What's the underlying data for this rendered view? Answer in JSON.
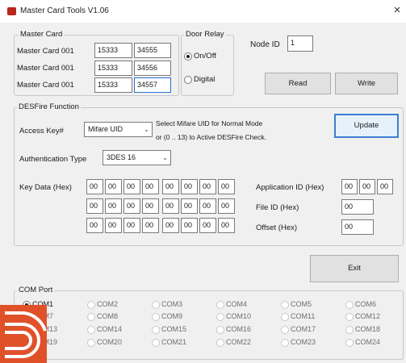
{
  "window": {
    "title": "Master Card Tools V1.06",
    "close_glyph": "×"
  },
  "master_card": {
    "legend": "Master Card",
    "rows": [
      {
        "label": "Master Card 001",
        "value1": "15333",
        "value2": "34555"
      },
      {
        "label": "Master Card 001",
        "value1": "15333",
        "value2": "34556"
      },
      {
        "label": "Master Card 001",
        "value1": "15333",
        "value2": "34557"
      }
    ]
  },
  "door_relay": {
    "legend": "Door Relay",
    "options": [
      "On/Off",
      "Digital"
    ],
    "selected": "On/Off"
  },
  "node": {
    "label": "Node ID",
    "value": "1"
  },
  "buttons": {
    "read": "Read",
    "write": "Write",
    "update": "Update",
    "exit": "Exit"
  },
  "desfire": {
    "legend": "DESFire Function",
    "access_key_label": "Access Key#",
    "access_key_value": "Mifare UID",
    "hint_line1": "Select  Mifare UID for Normal Mode",
    "hint_line2": "or (0 .. 13) to Active DESFire Check.",
    "auth_label": "Authentication Type",
    "auth_value": "3DES 16",
    "key_data_label": "Key Data  (Hex)",
    "key_data": [
      [
        "00",
        "00",
        "00",
        "00",
        "00",
        "00",
        "00",
        "00"
      ],
      [
        "00",
        "00",
        "00",
        "00",
        "00",
        "00",
        "00",
        "00"
      ],
      [
        "00",
        "00",
        "00",
        "00",
        "00",
        "00",
        "00",
        "00"
      ]
    ],
    "app_id_label": "Application ID  (Hex)",
    "app_id": [
      "00",
      "00",
      "00"
    ],
    "file_id_label": "File ID    (Hex)",
    "file_id": "00",
    "offset_label": "Offset    (Hex)",
    "offset": "00"
  },
  "com_port": {
    "legend": "COM Port",
    "ports": [
      "COM1",
      "COM2",
      "COM3",
      "COM4",
      "COM5",
      "COM6",
      "COM7",
      "COM8",
      "COM9",
      "COM10",
      "COM11",
      "COM12",
      "COM13",
      "COM14",
      "COM15",
      "COM16",
      "COM17",
      "COM18",
      "COM19",
      "COM20",
      "COM21",
      "COM22",
      "COM23",
      "COM24"
    ],
    "selected": "COM1"
  },
  "colors": {
    "accent": "#3c7fd1",
    "app_icon": "#b8261d",
    "logo": "#e0512a"
  },
  "icons": {
    "app": "card-icon",
    "close": "close-icon",
    "logo": "logo-icon"
  }
}
